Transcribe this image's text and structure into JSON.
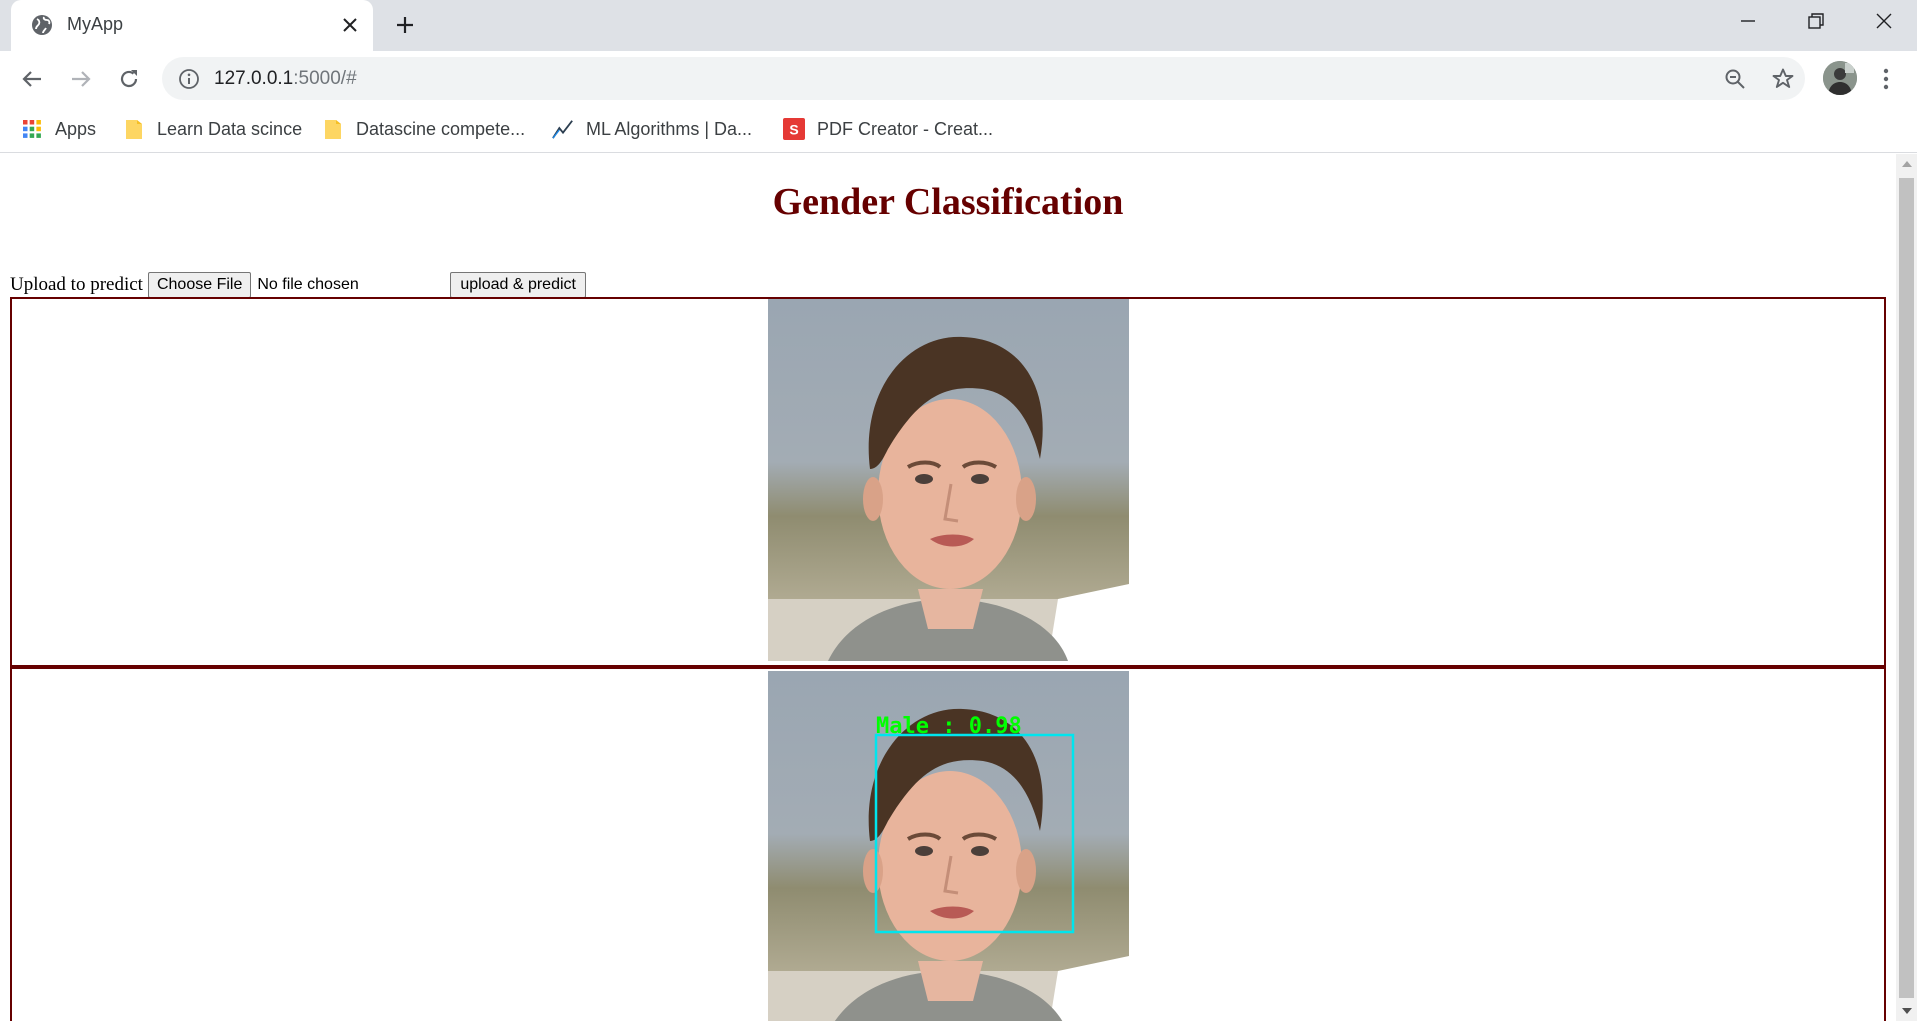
{
  "browser": {
    "tab_title": "MyApp",
    "url_host": "127.0.0.1",
    "url_path": ":5000/#",
    "bookmarks": [
      {
        "label": "Apps",
        "icon": "apps-grid-icon"
      },
      {
        "label": "Learn Data scince",
        "icon": "folder-icon"
      },
      {
        "label": "Datascine compete...",
        "icon": "folder-icon"
      },
      {
        "label": "ML Algorithms | Da...",
        "icon": "trend-line-icon"
      },
      {
        "label": "PDF Creator - Creat...",
        "icon": "pdf-creator-icon"
      }
    ],
    "colors": {
      "tab_strip": "#dee1e6",
      "omnibox": "#f1f3f4",
      "pdf_icon": "#e53935"
    }
  },
  "page": {
    "title": "Gender Classification",
    "upload_label": "Upload to predict",
    "choose_file_label": "Choose File",
    "file_status": "No file chosen",
    "predict_button": "upload & predict",
    "accent_color": "#660000"
  },
  "result": {
    "prediction_label": "Male : 0.98",
    "box_color": "#00e5ee",
    "label_color": "#00ff00"
  }
}
